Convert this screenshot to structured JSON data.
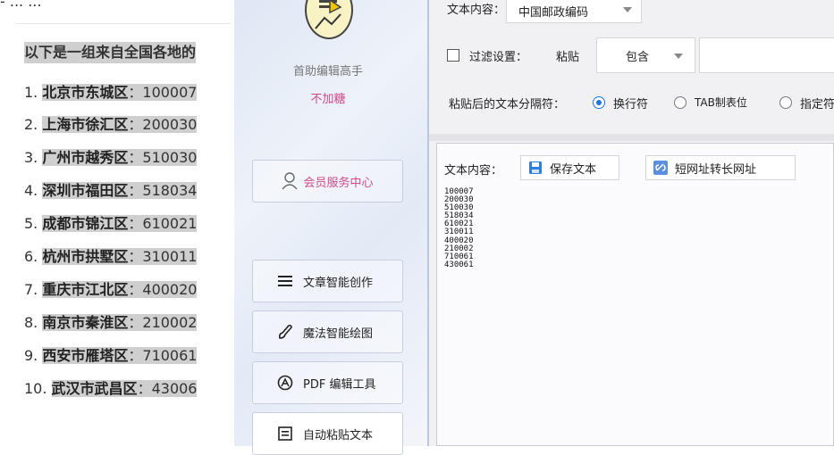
{
  "doc": {
    "top_line": "- ... ... ",
    "intro": "以下是一组来自全国各地的",
    "items": [
      {
        "num": "1.",
        "city": "北京市东城区",
        "colon": "：",
        "code": "100007"
      },
      {
        "num": "2.",
        "city": "上海市徐汇区",
        "colon": "：",
        "code": "200030"
      },
      {
        "num": "3.",
        "city": "广州市越秀区",
        "colon": "：",
        "code": "510030"
      },
      {
        "num": "4.",
        "city": "深圳市福田区",
        "colon": "：",
        "code": "518034"
      },
      {
        "num": "5.",
        "city": "成都市锦江区",
        "colon": "：",
        "code": "610021"
      },
      {
        "num": "6.",
        "city": "杭州市拱墅区",
        "colon": "：",
        "code": "310011"
      },
      {
        "num": "7.",
        "city": "重庆市江北区",
        "colon": "：",
        "code": "400020"
      },
      {
        "num": "8.",
        "city": "南京市秦淮区",
        "colon": "：",
        "code": "210002"
      },
      {
        "num": "9.",
        "city": "西安市雁塔区",
        "colon": "：",
        "code": "710061"
      },
      {
        "num": "10.",
        "city": "武汉市武昌区",
        "colon": "：",
        "code": "43006"
      }
    ]
  },
  "sidebar": {
    "logo_icon": "chart-note-icon",
    "app_name": "首助编辑高手",
    "app_sub": "不加糖",
    "member_button": "会员服务中心",
    "nav": [
      {
        "label": "文章智能创作",
        "icon": "menu-lines-icon"
      },
      {
        "label": "魔法智能绘图",
        "icon": "brush-icon"
      },
      {
        "label": "PDF 编辑工具",
        "icon": "pdf-circle-icon"
      },
      {
        "label": "自动粘贴文本",
        "icon": "paste-box-icon"
      }
    ],
    "accent_color": "#d04a8a"
  },
  "panel": {
    "content_type_label": "文本内容：",
    "content_type_value": "中国邮政编码",
    "filter_label": "过滤设置：",
    "paste_label": "粘贴",
    "filter_mode_value": "包含",
    "filter_text_value": "",
    "separator_label": "粘贴后的文本分隔符：",
    "separators": [
      {
        "label": "换行符",
        "selected": true
      },
      {
        "label": "TAB制表位",
        "selected": false
      },
      {
        "label": "指定符",
        "selected": false
      }
    ],
    "text_content_label": "文本内容：",
    "save_button": "保存文本",
    "url_button": "短网址转长网址",
    "output_lines": [
      "100007",
      "200030",
      "510030",
      "518034",
      "610021",
      "310011",
      "400020",
      "210002",
      "710061",
      "430061"
    ],
    "radio_color": "#1a73e8"
  }
}
